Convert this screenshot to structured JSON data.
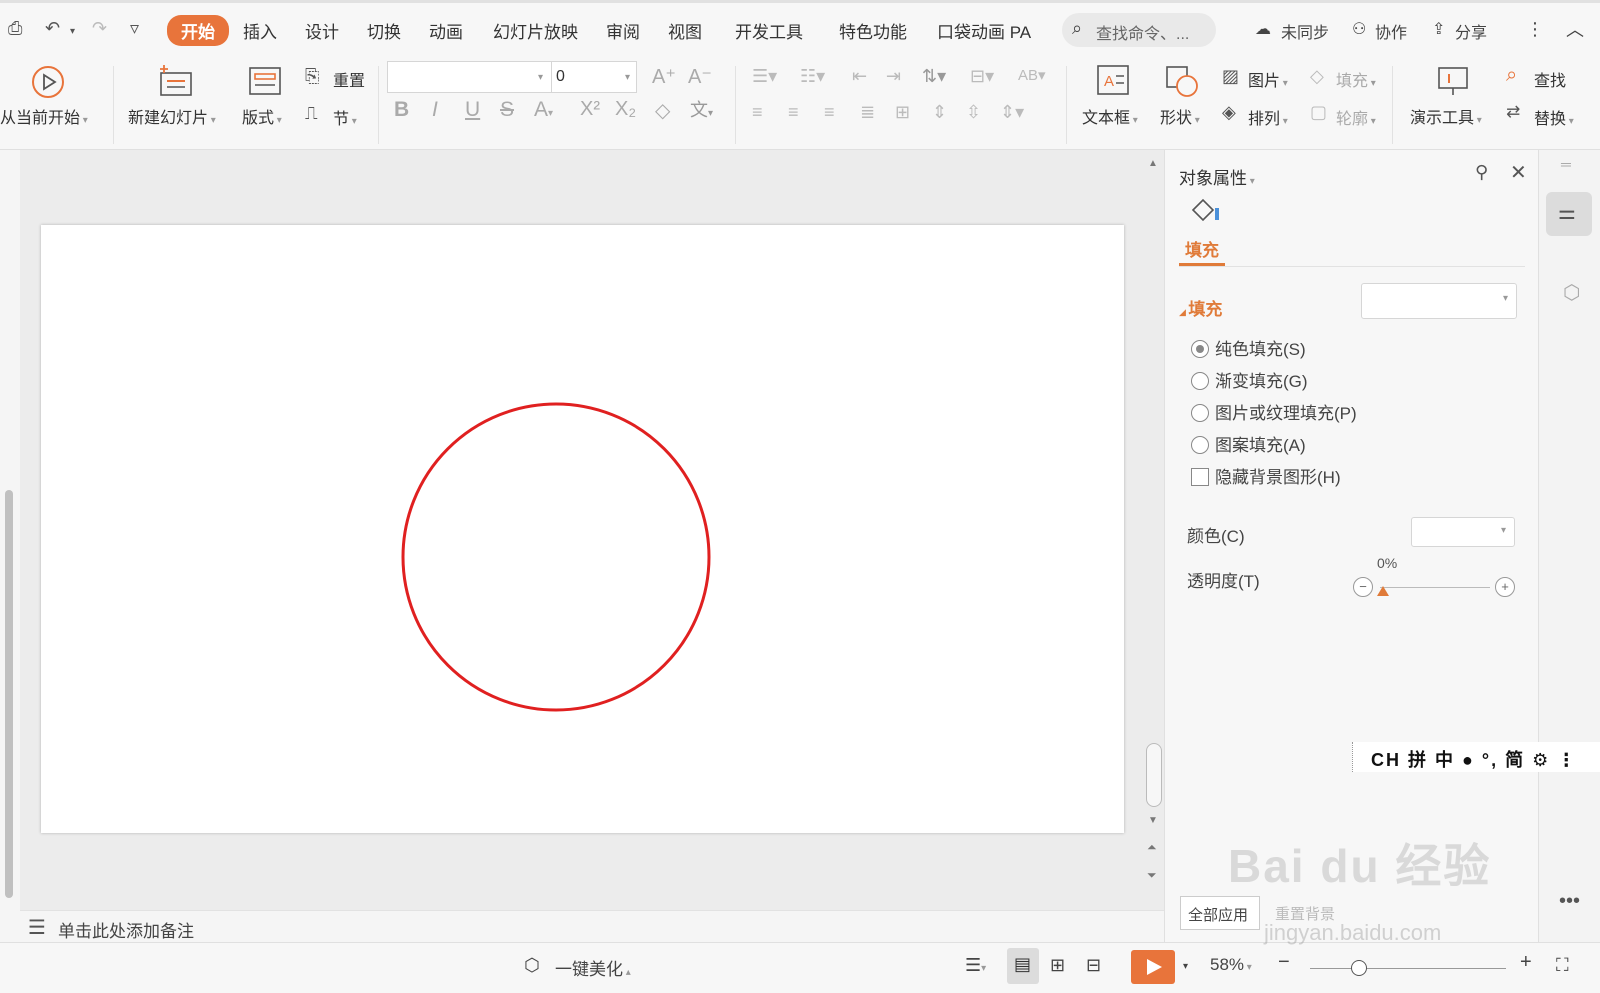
{
  "quick_access": {
    "preview_icon": "print-preview-icon",
    "undo_icon": "undo-icon",
    "redo_icon": "redo-icon",
    "customize_icon": "customize-down-icon"
  },
  "tabs": [
    {
      "label": "开始",
      "active": true
    },
    {
      "label": "插入"
    },
    {
      "label": "设计"
    },
    {
      "label": "切换"
    },
    {
      "label": "动画"
    },
    {
      "label": "幻灯片放映"
    },
    {
      "label": "审阅"
    },
    {
      "label": "视图"
    },
    {
      "label": "开发工具"
    },
    {
      "label": "特色功能"
    },
    {
      "label": "口袋动画 PA"
    }
  ],
  "search": {
    "placeholder": "查找命令、..."
  },
  "top_right": {
    "sync": "未同步",
    "collab": "协作",
    "share": "分享"
  },
  "ribbon": {
    "from_current": "从当前开始",
    "new_slide": "新建幻灯片",
    "layout": "版式",
    "reset": "重置",
    "section": "节",
    "font_name": "",
    "font_size": "0",
    "textbox": "文本框",
    "shape": "形状",
    "picture": "图片",
    "arrange": "排列",
    "fill": "填充",
    "outline": "轮廓",
    "present_tools": "演示工具",
    "find": "查找",
    "replace": "替换"
  },
  "notes": {
    "placeholder": "单击此处添加备注"
  },
  "panel": {
    "title": "对象属性",
    "fill_tab": "填充",
    "fill_section": "填充",
    "options": [
      {
        "label": "纯色填充(S)",
        "selected": true
      },
      {
        "label": "渐变填充(G)",
        "selected": false
      },
      {
        "label": "图片或纹理填充(P)",
        "selected": false
      },
      {
        "label": "图案填充(A)",
        "selected": false
      }
    ],
    "hide_bg": "隐藏背景图形(H)",
    "color_label": "颜色(C)",
    "transparency_label": "透明度(T)",
    "transparency_value": "0%",
    "apply_all": "全部应用",
    "reset_bg": "重置背景"
  },
  "ime": {
    "text": "CH 拼 中 ● °, 简 ⚙ ⋮"
  },
  "status": {
    "beautify": "一键美化",
    "zoom": "58%"
  },
  "slide": {
    "circle": {
      "stroke": "#e02020",
      "fill": "none"
    }
  },
  "colors": {
    "accent": "#e8743b",
    "panel_accent": "#e07b39"
  },
  "watermark": {
    "brand": "Bai du 经验",
    "url": "jingyan.baidu.com"
  }
}
